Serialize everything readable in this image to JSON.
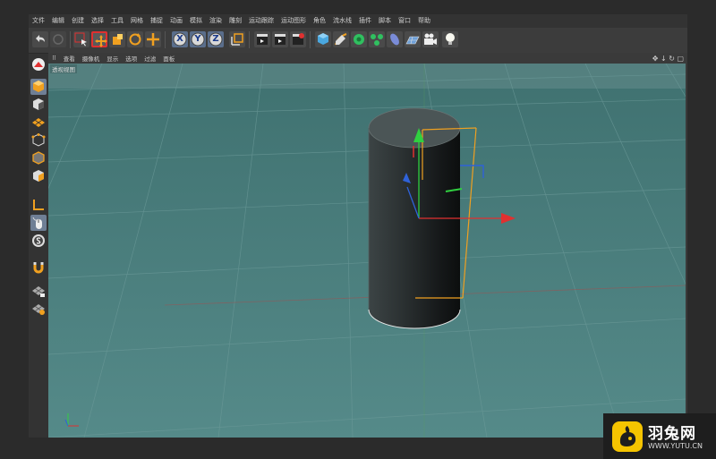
{
  "menubar": {
    "items": [
      "文件",
      "编辑",
      "创建",
      "选择",
      "工具",
      "网格",
      "捕捉",
      "动画",
      "模拟",
      "渲染",
      "雕刻",
      "运动跟踪",
      "运动图形",
      "角色",
      "流水线",
      "插件",
      "脚本",
      "窗口",
      "帮助"
    ]
  },
  "viewport": {
    "menu": [
      "查看",
      "摄像机",
      "显示",
      "选项",
      "过滤",
      "面板"
    ],
    "label": "透视视图"
  },
  "toolbar": {
    "axis_x": "X",
    "axis_y": "Y",
    "axis_z": "Z"
  },
  "watermark": {
    "name": "羽兔网",
    "url": "WWW.YUTU.CN"
  },
  "colors": {
    "viewport_bg": "#4a7f7e",
    "accent_orange": "#f0a020",
    "active_red": "#e03030",
    "axis_blue": "#2f62d8"
  }
}
